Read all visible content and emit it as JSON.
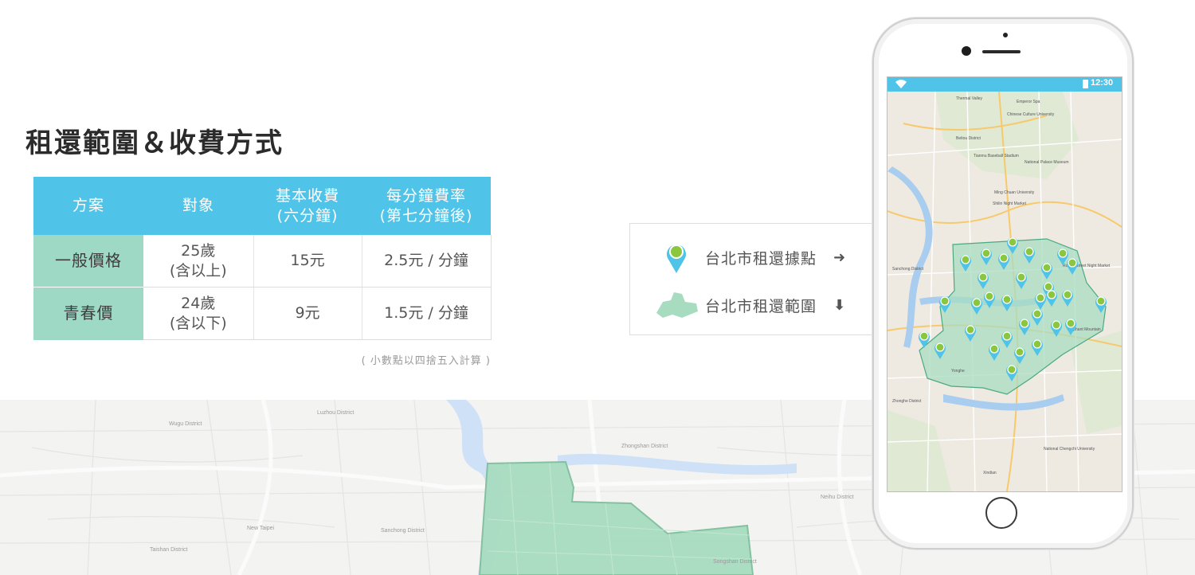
{
  "page": {
    "title": "租還範圍＆收費方式"
  },
  "pricing_table": {
    "headers": [
      "方案",
      "對象",
      "基本收費\n(六分鐘)",
      "每分鐘費率\n(第七分鐘後)"
    ],
    "rows": [
      {
        "plan": "一般價格",
        "target": "25歲\n(含以上)",
        "base_fee": "15元",
        "per_minute": "2.5元 / 分鐘"
      },
      {
        "plan": "青春價",
        "target": "24歲\n(含以下)",
        "base_fee": "9元",
        "per_minute": "1.5元 / 分鐘"
      }
    ],
    "note": "( 小數點以四捨五入計算 )"
  },
  "legend": {
    "items": [
      {
        "label": "台北市租還據點",
        "icon": "map-pin-icon",
        "arrow": "arrow-right-icon"
      },
      {
        "label": "台北市租還範圍",
        "icon": "area-shape-icon",
        "arrow": "arrow-down-icon"
      }
    ]
  },
  "phone": {
    "status_time": "12:30",
    "map_labels": {
      "thermal_valley": "Thermal Valley",
      "emperor_spa": "Emperor Spa",
      "chinese_culture_university": "Chinese Culture University",
      "beitou_district": "Beitou District",
      "tianmu_stadium": "Tianmu Baseball Stadium",
      "national_palace_museum": "National Palace Museum",
      "ming_chuan_university": "Ming Chuan University",
      "shilin_night_market": "Shilin Night Market",
      "sanchong_district": "Sanchong District",
      "raohe_night_market": "Raohe Street Night Market",
      "elephant_mountain": "Elephant Mountain",
      "xindian": "Xindian",
      "zhonghe": "Zhonghe District",
      "yonghe": "Yonghe",
      "national_chengchi_university": "National Chengchi University"
    }
  },
  "background_map": {
    "labels": {
      "wugu": "Wugu District",
      "luzhou": "Luzhou District",
      "zhongshan": "Zhongshan District",
      "sanchong": "Sanchong District",
      "new_taipei": "New Taipei",
      "taishan": "Taishan District",
      "neihu": "Neihu District",
      "songshan": "Songshan District"
    }
  },
  "colors": {
    "table_header": "#4fc3e8",
    "plan_cell": "#9ed9c6",
    "area_fill": "#a8dcc1",
    "pin": "#8cc63f",
    "pin_body": "#4fc3e8"
  }
}
